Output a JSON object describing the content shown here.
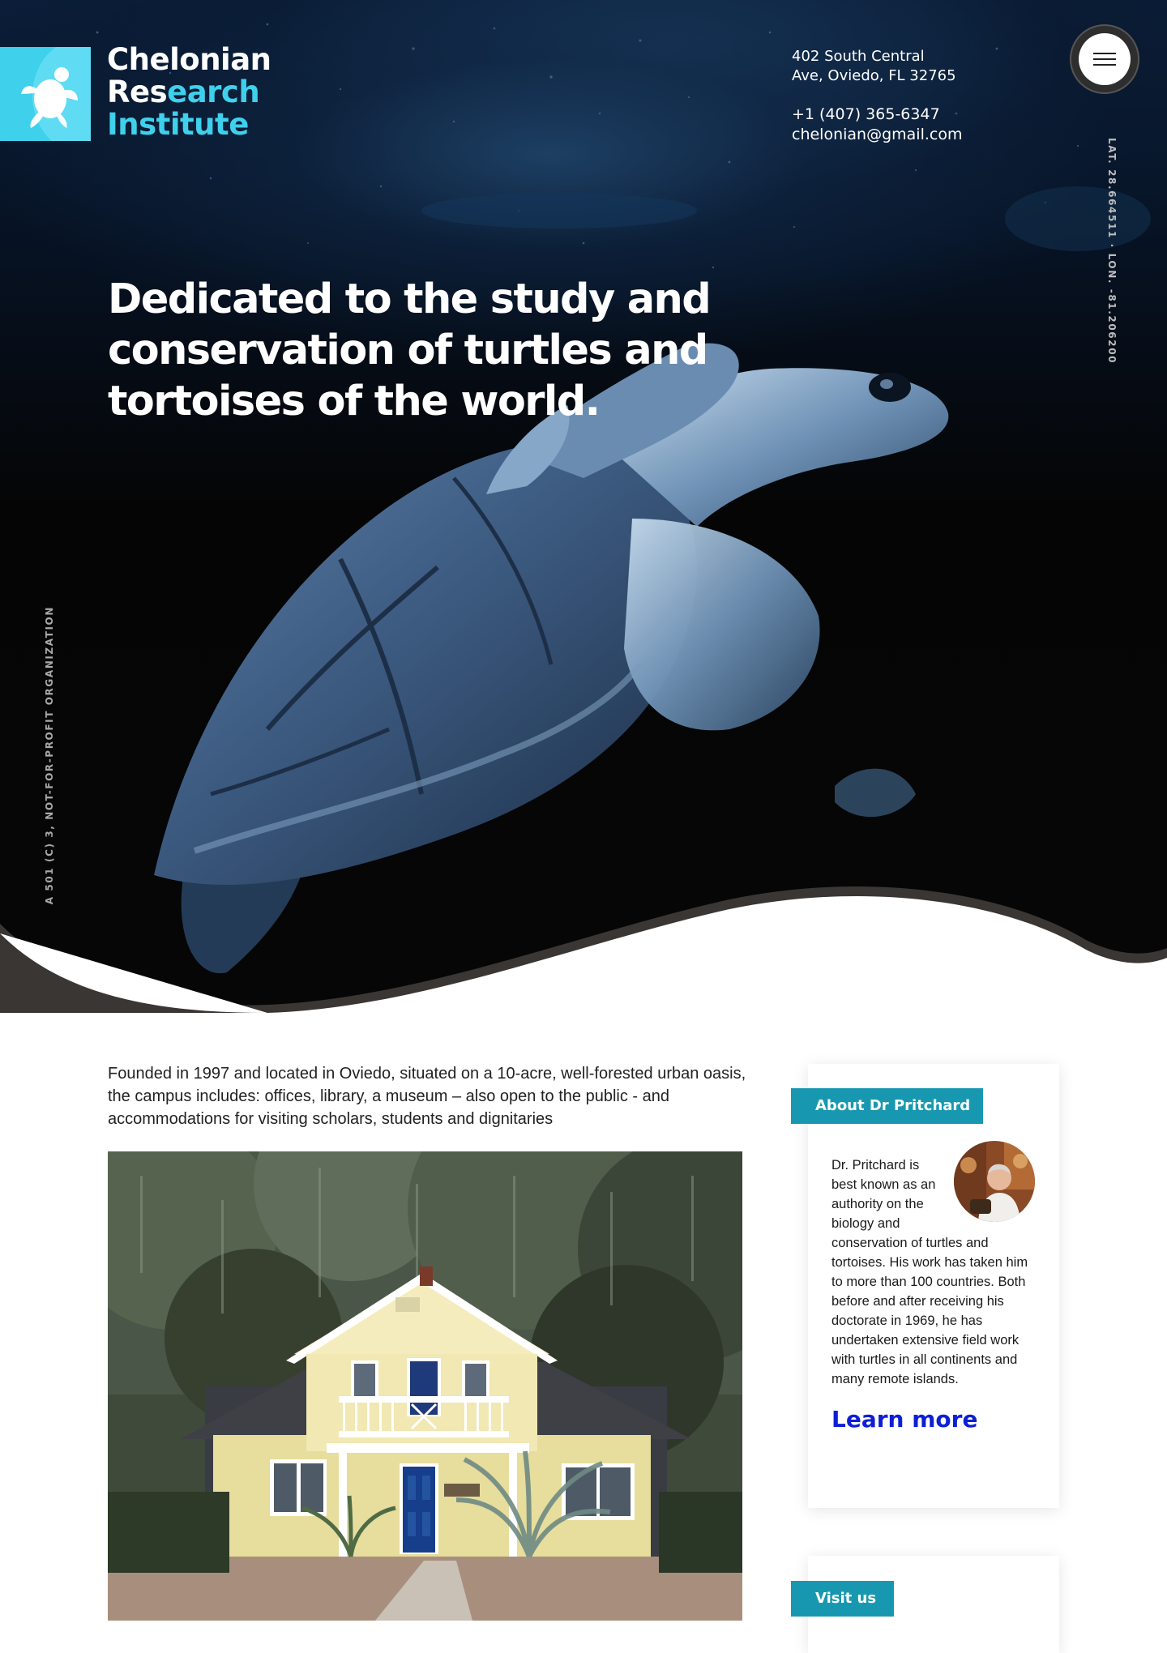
{
  "header": {
    "logo": {
      "line1": "Chelonian",
      "line2_white": "Res",
      "line2_cyan": "earch",
      "line3": "Institute"
    },
    "address_line1": "402 South Central",
    "address_line2": "Ave, Oviedo, FL 32765",
    "phone": "+1 (407) 365-6347",
    "email": "chelonian@gmail.com",
    "menu_icon": "hamburger-icon"
  },
  "hero": {
    "title": "Dedicated to the study and conservation of turtles and tortoises of the world.",
    "coordinates": "LAT. 28.664511 · LON. -81.206200",
    "org_status": "A 501 (C) 3, NOT-FOR-PROFIT ORGANIZATION"
  },
  "main": {
    "intro": "Founded in 1997 and located in Oviedo, situated on a 10-acre, well-forested urban oasis, the campus includes: offices, library, a museum – also open to the public - and accommodations for visiting scholars, students and dignitaries"
  },
  "sidebar": {
    "about": {
      "tag": "About Dr Pritchard",
      "bio_narrow": "Dr. Pritchard is best known as an authority on the biology and",
      "bio_rest": "conservation of turtles and tortoises. His work has taken him to more than 100 countries. Both before and after receiving his doctorate in 1969, he has undertaken extensive field work with turtles in all continents and many remote islands.",
      "link": "Learn more"
    },
    "visit": {
      "tag": "Visit us"
    }
  },
  "colors": {
    "accent": "#3fd0ec",
    "tag_bg": "#1898b0",
    "link": "#0d1fd6"
  }
}
